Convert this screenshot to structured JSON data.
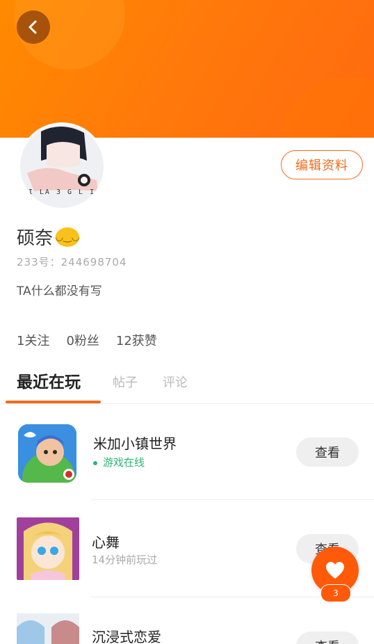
{
  "profile": {
    "nickname": "硕奈",
    "uid_text": "233号：244698704",
    "bio": "TA什么都没有写",
    "edit_button": "编辑资料",
    "avatar_caption": "KI LA 3 G L I4"
  },
  "stats": {
    "following": "1关注",
    "fans": "0粉丝",
    "likes": "12获赞"
  },
  "tabs": [
    "最近在玩",
    "帖子",
    "评论"
  ],
  "games": [
    {
      "title": "米加小镇世界",
      "status": "游戏在线",
      "button": "查看",
      "online": true
    },
    {
      "title": "心舞",
      "status": "14分钟前玩过",
      "button": "查看",
      "online": false
    },
    {
      "title": "沉浸式恋爱",
      "status": "",
      "button": "查看",
      "online": false
    }
  ],
  "fab": {
    "badge": "3"
  },
  "colors": {
    "accent": "#f26a1b",
    "online": "#2bb673",
    "banner": "#ff7a0a"
  }
}
